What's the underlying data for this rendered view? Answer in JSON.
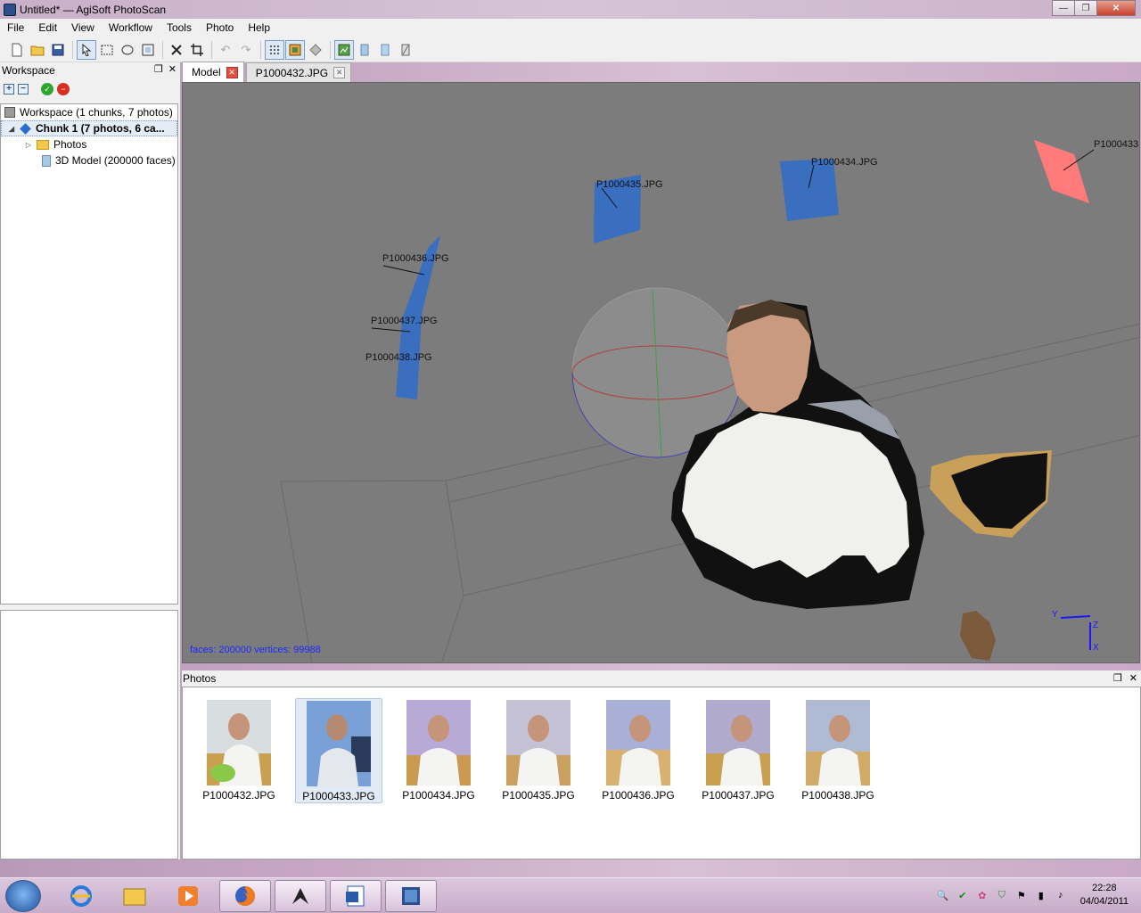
{
  "window": {
    "title": "Untitled* — AgiSoft PhotoScan",
    "min_glyph": "—",
    "max_glyph": "❐",
    "close_glyph": "✕"
  },
  "menu": [
    "File",
    "Edit",
    "View",
    "Workflow",
    "Tools",
    "Photo",
    "Help"
  ],
  "toolbar": {
    "icons": [
      "new-file-icon",
      "open-folder-icon",
      "save-icon",
      "pointer-icon",
      "rect-select-icon",
      "ellipse-select-icon",
      "free-select-icon",
      "delete-icon",
      "crop-icon",
      "undo-icon",
      "redo-icon",
      "point-cloud-icon",
      "textured-icon",
      "shaded-icon",
      "camera-show-icon",
      "align-icon",
      "build-icon",
      "texture-icon"
    ]
  },
  "workspace": {
    "header": "Workspace",
    "tree": [
      {
        "label": "Workspace (1 chunks, 7 photos)",
        "icon": "workspace-icon"
      },
      {
        "label": "Chunk 1 (7 photos, 6 ca...",
        "icon": "chunk-icon",
        "selected": true
      },
      {
        "label": "Photos",
        "icon": "folder-icon"
      },
      {
        "label": "3D Model (200000 faces)",
        "icon": "model-icon"
      }
    ]
  },
  "tabs": [
    {
      "label": "Model",
      "active": true
    },
    {
      "label": "P1000432.JPG",
      "active": false
    }
  ],
  "viewport": {
    "status": "faces: 200000 vertices: 99988",
    "camera_labels": [
      "P1000433.",
      "P1000434.JPG",
      "P1000435.JPG",
      "P1000436.JPG",
      "P1000437.JPG",
      "P1000438.JPG"
    ],
    "axis_labels": {
      "y": "Y",
      "z": "Z",
      "x": "X"
    }
  },
  "photos_panel": {
    "header": "Photos",
    "photos": [
      {
        "name": "P1000432.JPG",
        "selected": false,
        "bg": "#dfe3e6"
      },
      {
        "name": "P1000433.JPG",
        "selected": true,
        "bg": "#7aa0d8"
      },
      {
        "name": "P1000434.JPG",
        "selected": false,
        "bg": "#b8a9d6"
      },
      {
        "name": "P1000435.JPG",
        "selected": false,
        "bg": "#c4c2d4"
      },
      {
        "name": "P1000436.JPG",
        "selected": false,
        "bg": "#a8b0d8"
      },
      {
        "name": "P1000437.JPG",
        "selected": false,
        "bg": "#b0aacd"
      },
      {
        "name": "P1000438.JPG",
        "selected": false,
        "bg": "#aebbd2"
      }
    ]
  },
  "taskbar": {
    "items": [
      "internet-explorer-icon",
      "file-explorer-icon",
      "media-player-icon",
      "firefox-icon",
      "zbrush-icon",
      "word-icon",
      "photoscan-icon"
    ],
    "clock_time": "22:28",
    "clock_date": "04/04/2011"
  },
  "colors": {
    "viewport_bg": "#7c7c7c",
    "camera_blue": "#3a6fc0",
    "camera_selected": "#ff7a7a",
    "status_text": "#1a2aff"
  }
}
